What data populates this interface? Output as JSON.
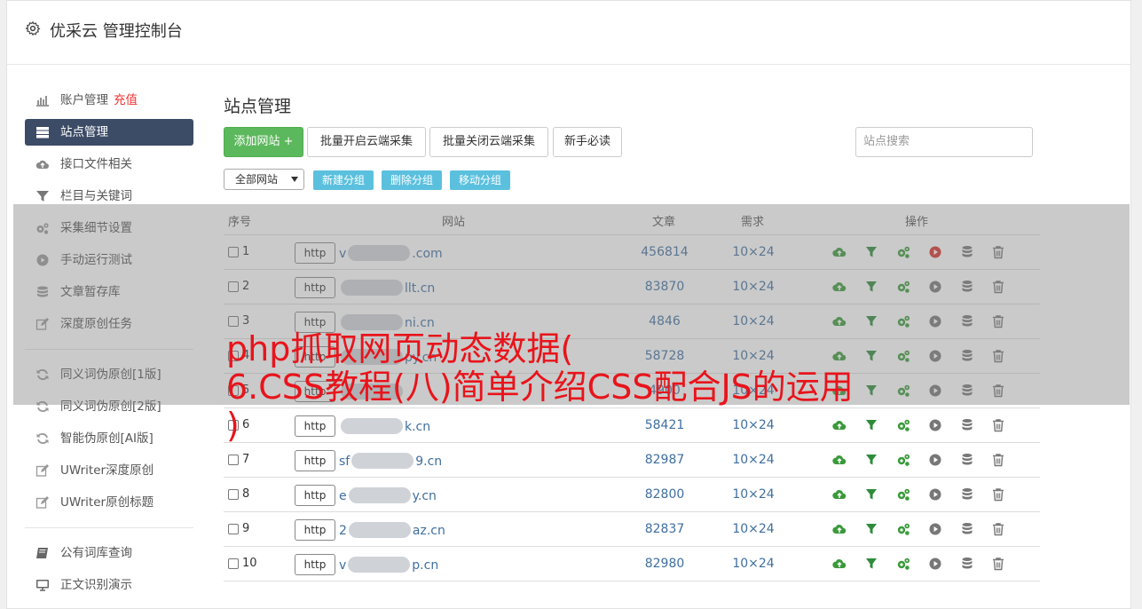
{
  "header": {
    "title": "优采云 管理控制台",
    "icon": "gear-icon"
  },
  "sidebar": {
    "groups": [
      [
        {
          "label": "账户管理",
          "badge": "充值",
          "icon": "bar-chart-icon"
        },
        {
          "label": "站点管理",
          "icon": "server-icon",
          "active": true
        },
        {
          "label": "接口文件相关",
          "icon": "cloud-upload-icon"
        },
        {
          "label": "栏目与关键词",
          "icon": "filter-icon"
        },
        {
          "label": "采集细节设置",
          "icon": "gears-icon"
        },
        {
          "label": "手动运行测试",
          "icon": "play-circle-icon"
        },
        {
          "label": "文章暂存库",
          "icon": "database-icon"
        },
        {
          "label": "深度原创任务",
          "icon": "edit-icon"
        }
      ],
      [
        {
          "label": "同义词伪原创[1版]",
          "icon": "refresh-icon"
        },
        {
          "label": "同义词伪原创[2版]",
          "icon": "refresh-icon"
        },
        {
          "label": "智能伪原创[AI版]",
          "icon": "refresh-icon"
        },
        {
          "label": "UWriter深度原创",
          "icon": "edit-icon"
        },
        {
          "label": "UWriter原创标题",
          "icon": "edit-icon"
        }
      ],
      [
        {
          "label": "公有词库查询",
          "icon": "book-icon"
        },
        {
          "label": "正文识别演示",
          "icon": "monitor-icon"
        }
      ]
    ]
  },
  "main": {
    "title": "站点管理",
    "buttons": {
      "add": "添加网站 +",
      "batch_on": "批量开启云端采集",
      "batch_off": "批量关闭云端采集",
      "guide": "新手必读"
    },
    "search_placeholder": "站点搜索",
    "group_select": "全部网站",
    "group_buttons": [
      "新建分组",
      "删除分组",
      "移动分组"
    ],
    "table": {
      "headers": {
        "no": "序号",
        "site": "网站",
        "articles": "文章",
        "demand": "需求",
        "ops": "操作"
      },
      "rows": [
        {
          "no": "1",
          "proto": "http",
          "prefix": "v",
          "suffix": ".com",
          "articles": "456814",
          "demand": "10×24",
          "running": true
        },
        {
          "no": "2",
          "proto": "http",
          "prefix": "",
          "suffix": "llt.cn",
          "articles": "83870",
          "demand": "10×24",
          "running": false
        },
        {
          "no": "3",
          "proto": "http",
          "prefix": "",
          "suffix": "ni.cn",
          "articles": "4846",
          "demand": "10×24",
          "running": false
        },
        {
          "no": "4",
          "proto": "http",
          "prefix": "",
          "suffix": "py.cn",
          "articles": "58728",
          "demand": "10×24",
          "running": false
        },
        {
          "no": "5",
          "proto": "http",
          "prefix": "",
          "suffix": "",
          "articles": "4900",
          "demand": "10×24",
          "running": false
        },
        {
          "no": "6",
          "proto": "http",
          "prefix": "",
          "suffix": "k.cn",
          "articles": "58421",
          "demand": "10×24",
          "running": false
        },
        {
          "no": "7",
          "proto": "http",
          "prefix": "sf",
          "suffix": "9.cn",
          "articles": "82987",
          "demand": "10×24",
          "running": false
        },
        {
          "no": "8",
          "proto": "http",
          "prefix": "e",
          "suffix": "y.cn",
          "articles": "82800",
          "demand": "10×24",
          "running": false
        },
        {
          "no": "9",
          "proto": "http",
          "prefix": "2",
          "suffix": "az.cn",
          "articles": "82837",
          "demand": "10×24",
          "running": false
        },
        {
          "no": "10",
          "proto": "http",
          "prefix": "v",
          "suffix": "p.cn",
          "articles": "82980",
          "demand": "10×24",
          "running": false
        }
      ]
    }
  },
  "overlay": {
    "line1": "php抓取网页动态数据(",
    "line2": "6.CSS教程(八)简单介绍CSS配合JS的运用",
    "line3": ")"
  },
  "colors": {
    "accent_green": "#5cb85c",
    "active_nav": "#3c4b66",
    "info_blue": "#5bc0de",
    "overlay_red": "#e8141b",
    "link_blue": "#3f6f9f"
  }
}
